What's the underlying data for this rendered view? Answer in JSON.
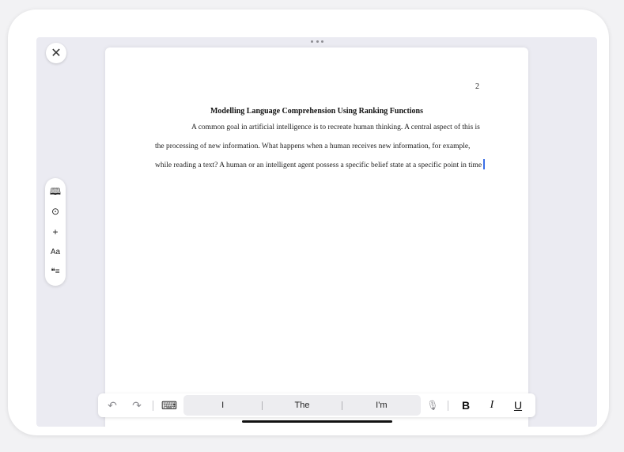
{
  "window": {
    "close_glyph": "✕"
  },
  "document": {
    "page_number": "2",
    "title": "Modelling Language Comprehension Using Ranking Functions",
    "body": "A common goal in artificial intelligence is to recreate human thinking. A central aspect of this is the processing of new information. What happens when a human receives new information, for example, while reading a text? A human or an intelligent agent possess a specific belief state at a specific point in time"
  },
  "side_toolbar": {
    "items": [
      {
        "name": "book-icon",
        "glyph": "🕮"
      },
      {
        "name": "more-icon",
        "glyph": "⊙"
      },
      {
        "name": "add-icon",
        "glyph": "+"
      },
      {
        "name": "font-icon",
        "glyph": "Aa"
      },
      {
        "name": "quote-icon",
        "glyph": "❝≡"
      }
    ]
  },
  "bottom_bar": {
    "undo_glyph": "↶",
    "redo_glyph": "↷",
    "keyboard_glyph": "⌨",
    "suggestions": [
      "I",
      "The",
      "I'm"
    ],
    "mic_glyph": "🎙",
    "bold_label": "B",
    "italic_label": "I",
    "underline_label": "U"
  },
  "colors": {
    "cursor": "#3b6fe6",
    "screen_bg": "#ebebf2"
  }
}
